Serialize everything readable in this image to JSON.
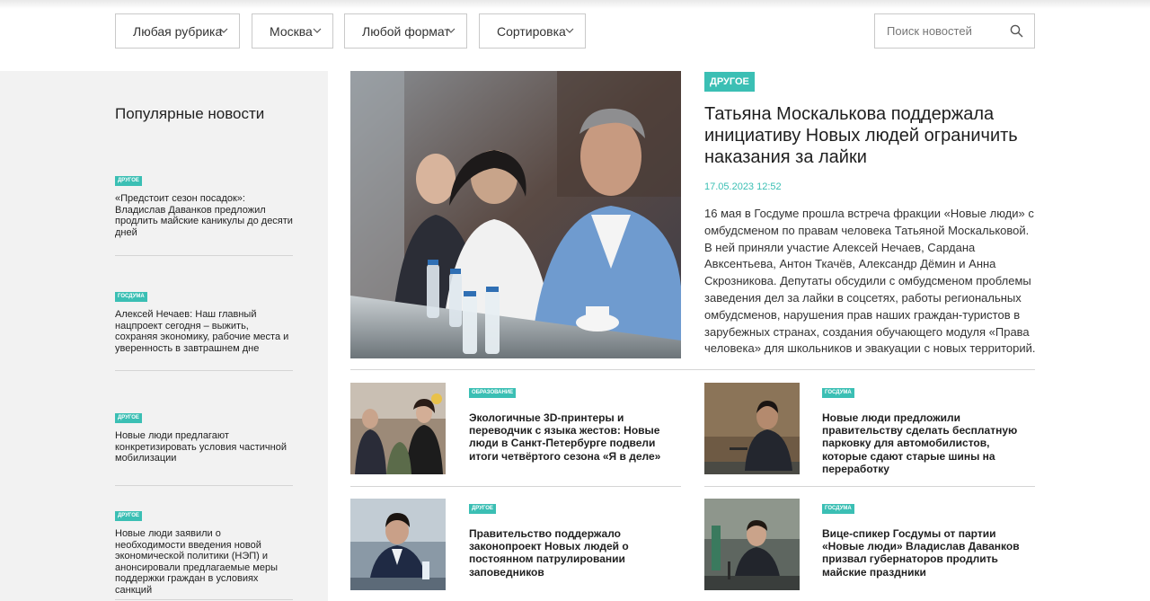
{
  "filters": {
    "rubric": "Любая рубрика",
    "city": "Москва",
    "format": "Любой формат",
    "sort": "Сортировка"
  },
  "search": {
    "placeholder": "Поиск новостей"
  },
  "sidebar": {
    "title": "Популярные новости",
    "items": [
      {
        "tag": "Другое",
        "text": "«Предстоит сезон посадок»: Владислав Даванков предложил продлить майские каникулы до десяти дней"
      },
      {
        "tag": "Госдума",
        "text": "Алексей Нечаев: Наш главный нацпроект сегодня – выжить, сохраняя экономику, рабочие места и уверенность в завтрашнем дне"
      },
      {
        "tag": "Другое",
        "text": "Новые люди предлагают конкретизировать условия частичной мобилизации"
      },
      {
        "tag": "Другое",
        "text": "Новые люди заявили о необходимости введения новой экономической политики (НЭП) и анонсировали предлагаемые меры поддержки граждан в условиях санкций"
      }
    ]
  },
  "featured": {
    "tag": "Другое",
    "title": "Татьяна Москалькова поддержала инициативу Новых людей ограничить наказания за лайки",
    "date": "17.05.2023 12:52",
    "text": "16 мая в Госдуме прошла встреча фракции «Новые люди» с омбудсменом по правам человека Татьяной Москальковой. В ней приняли участие Алексей Нечаев, Сардана Авксентьева, Антон Ткачёв, Александр Дёмин и Анна Скрозникова. Депутаты обсудили с омбудсменом проблемы заведения дел за лайки в соцсетях, работы региональных омбудсменов, нарушения прав наших граждан-туристов в зарубежных странах, создания обучающего модуля «Права человека» для школьников и эвакуации с новых территорий."
  },
  "cards": [
    {
      "tag": "Образование",
      "title": "Экологичные 3D-принтеры и переводчик с языка жестов: Новые люди в Санкт-Петербурге подвели итоги четвёртого сезона «Я в деле»"
    },
    {
      "tag": "Госдума",
      "title": "Новые люди предложили правительству сделать бесплатную парковку для автомобилистов, которые сдают старые шины на переработку"
    },
    {
      "tag": "Другое",
      "title": "Правительство поддержало законопроект Новых людей о постоянном патрулировании заповедников"
    },
    {
      "tag": "Госдума",
      "title": "Вице-спикер Госдумы от партии «Новые люди» Владислав Даванков призвал губернаторов продлить майские праздники"
    }
  ],
  "colors": {
    "accent": "#3bbfb4",
    "sidebar_bg": "#f2f2f2",
    "border": "#c9c9c9"
  },
  "icons": {
    "search": "search-icon",
    "dropdown": "chevron-down-icon"
  }
}
